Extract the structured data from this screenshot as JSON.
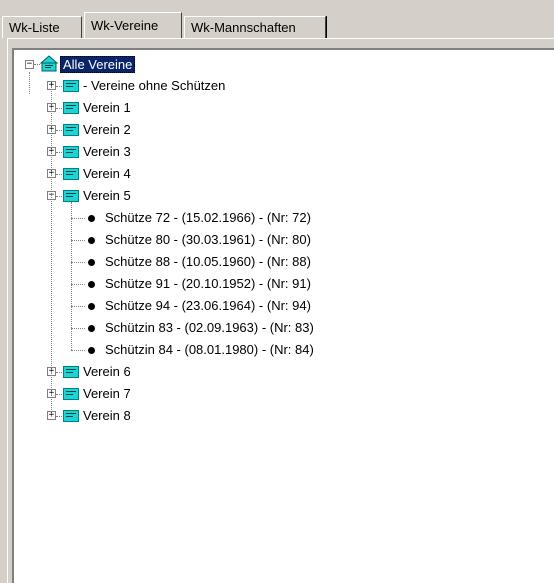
{
  "tabs": [
    {
      "label": "Wk-Liste",
      "active": false
    },
    {
      "label": "Wk-Vereine",
      "active": true
    },
    {
      "label": "Wk-Mannschaften",
      "active": false
    }
  ],
  "tree": {
    "root": {
      "label": "Alle Vereine",
      "selected": true,
      "expanded": true
    },
    "clubs": [
      {
        "label": "- Vereine ohne Schützen",
        "expanded": false
      },
      {
        "label": "Verein 1",
        "expanded": false
      },
      {
        "label": "Verein 2",
        "expanded": false
      },
      {
        "label": "Verein 3",
        "expanded": false
      },
      {
        "label": "Verein 4",
        "expanded": false
      },
      {
        "label": "Verein 5",
        "expanded": true,
        "members": [
          "Schütze 72 - (15.02.1966) - (Nr: 72)",
          "Schütze 80 - (30.03.1961) - (Nr: 80)",
          "Schütze 88 - (10.05.1960) - (Nr: 88)",
          "Schütze 91 - (20.10.1952) - (Nr: 91)",
          "Schütze 94 - (23.06.1964) - (Nr: 94)",
          "Schützin 83 - (02.09.1963) - (Nr: 83)",
          "Schützin 84 - (08.01.1980) - (Nr: 84)"
        ]
      },
      {
        "label": "Verein 6",
        "expanded": false
      },
      {
        "label": "Verein 7",
        "expanded": false
      },
      {
        "label": "Verein 8",
        "expanded": false
      }
    ]
  },
  "icons": {
    "root": "home-folder-icon",
    "club": "club-icon",
    "member": "member-bullet-icon"
  },
  "colors": {
    "selection": "#0a246a",
    "club_icon": "#1bd4d4"
  }
}
